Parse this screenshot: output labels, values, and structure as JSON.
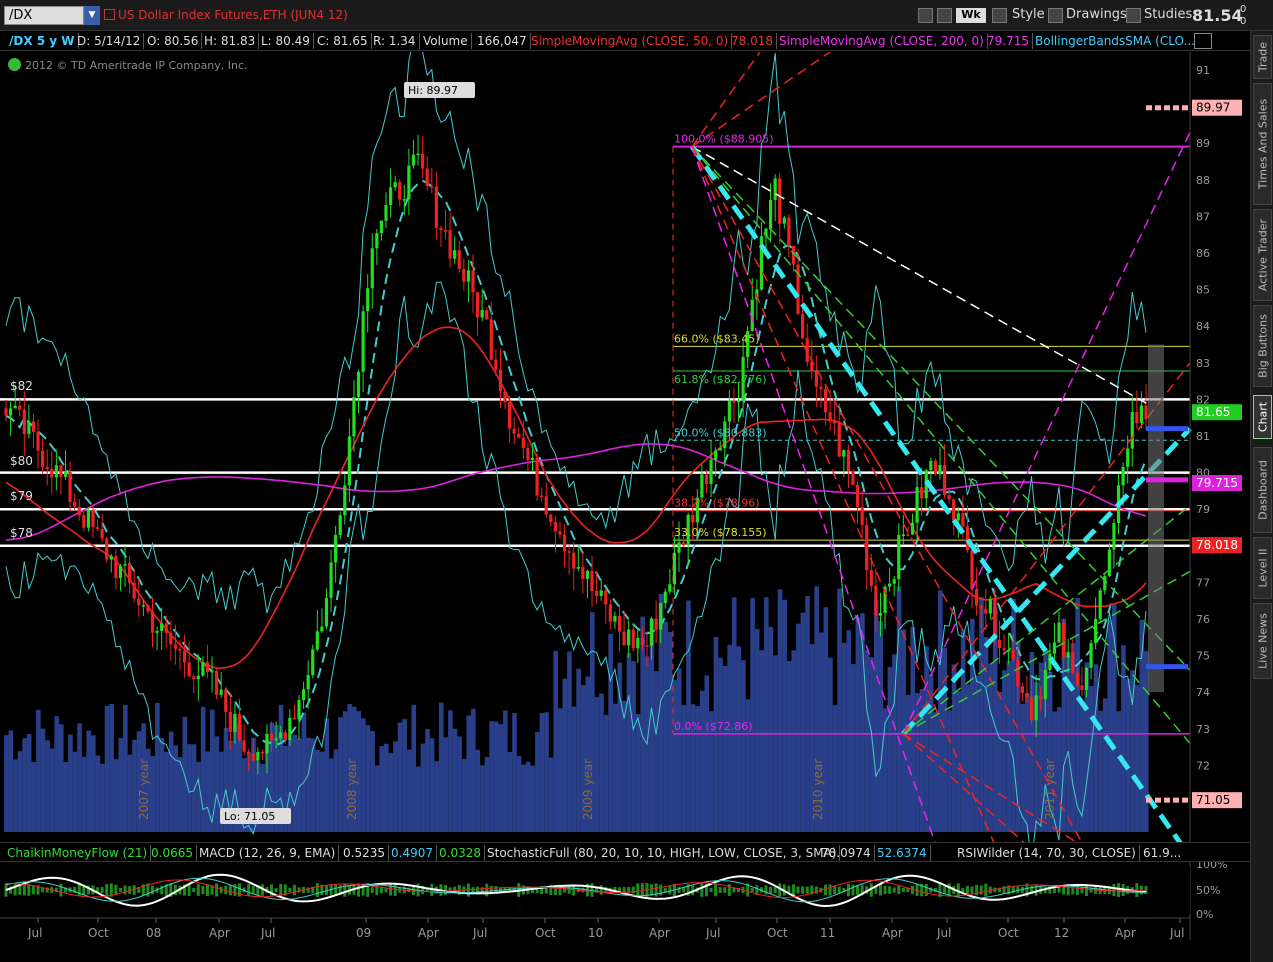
{
  "toolbar": {
    "symbol": "/DX",
    "description": "US Dollar Index Futures,ETH (JUN4 12)",
    "aggregation": "Wk",
    "style_label": "Style",
    "drawings_label": "Drawings",
    "studies_label": "Studies",
    "last_price": "81.54",
    "change_top": "0",
    "change_bottom": "0"
  },
  "studies_row": {
    "period": "/DX 5 y W",
    "date": "D: 5/14/12",
    "open": "O: 80.56",
    "high": "H: 81.83",
    "low": "L: 80.49",
    "close": "C: 81.65",
    "range": "R: 1.34",
    "volume_label": "Volume",
    "volume_value": "166,047",
    "sma50_label": "SimpleMovingAvg (CLOSE, 50, 0)",
    "sma50_value": "78.018",
    "sma200_label": "SimpleMovingAvg (CLOSE, 200, 0)",
    "sma200_value": "79.715",
    "bollinger_label": "BollingerBandsSMA (CLO..."
  },
  "copyright": "2012 © TD Ameritrade IP Company, Inc.",
  "price_axis": [
    "91",
    "90",
    "89",
    "88",
    "87",
    "86",
    "85",
    "84",
    "83",
    "82",
    "81",
    "80",
    "79",
    "78",
    "77",
    "76",
    "75",
    "74",
    "73",
    "72",
    "71"
  ],
  "price_tags": {
    "high": "89.97",
    "last": "81.65",
    "sma200": "79.715",
    "sma50": "78.018",
    "low": "71.05"
  },
  "annotations": {
    "hi": "Hi: 89.97",
    "lo": "Lo: 71.05",
    "h82": "$82",
    "h80": "$80",
    "h79": "$79",
    "h78": "$78"
  },
  "fib_labels": [
    "100.0%  ($88.905)",
    "66.0%  ($83.45)",
    "61.8%  ($82.776)",
    "50.0%  ($80.883)",
    "38.2%  ($78.96)",
    "33.0%  ($78.155)",
    "0.0%  ($72.86)"
  ],
  "year_labels": [
    "2007 year",
    "2008 year",
    "2009 year",
    "2010 year",
    "2011 year"
  ],
  "lower_studies": {
    "cmf": "ChaikinMoneyFlow (21)",
    "cmf_value": "0.0665",
    "macd": "MACD (12, 26, 9, EMA)",
    "macd_v1": "0.5235",
    "macd_v2": "0.4907",
    "macd_v3": "0.0328",
    "stoch": "StochasticFull (80, 20, 10, 10, HIGH, LOW, CLOSE, 3, SMA)",
    "stoch_v1": "78.0974",
    "stoch_v2": "52.6374",
    "rsi": "RSIWilder (14, 70, 30, CLOSE)",
    "rsi_v": "61.9..."
  },
  "lower_axis": [
    "100%",
    "50%",
    "0%"
  ],
  "time_axis": [
    "Jul",
    "Oct",
    "08",
    "Apr",
    "Jul",
    "09",
    "Apr",
    "Jul",
    "Oct",
    "10",
    "Apr",
    "Jul",
    "Oct",
    "11",
    "Apr",
    "Jul",
    "Oct",
    "12",
    "Apr",
    "Jul"
  ],
  "right_tabs": [
    "Trade",
    "Times And Sales",
    "Active Trader",
    "Big Buttons",
    "Chart",
    "Dashboard",
    "Level II",
    "Live News"
  ],
  "colors": {
    "up": "#22dd22",
    "down": "#ee2222",
    "sma50": "#ee2222",
    "sma200": "#dd22dd",
    "bollinger": "#44cccc",
    "volume": "#2a3f8a",
    "fib": "#dd22dd"
  }
}
